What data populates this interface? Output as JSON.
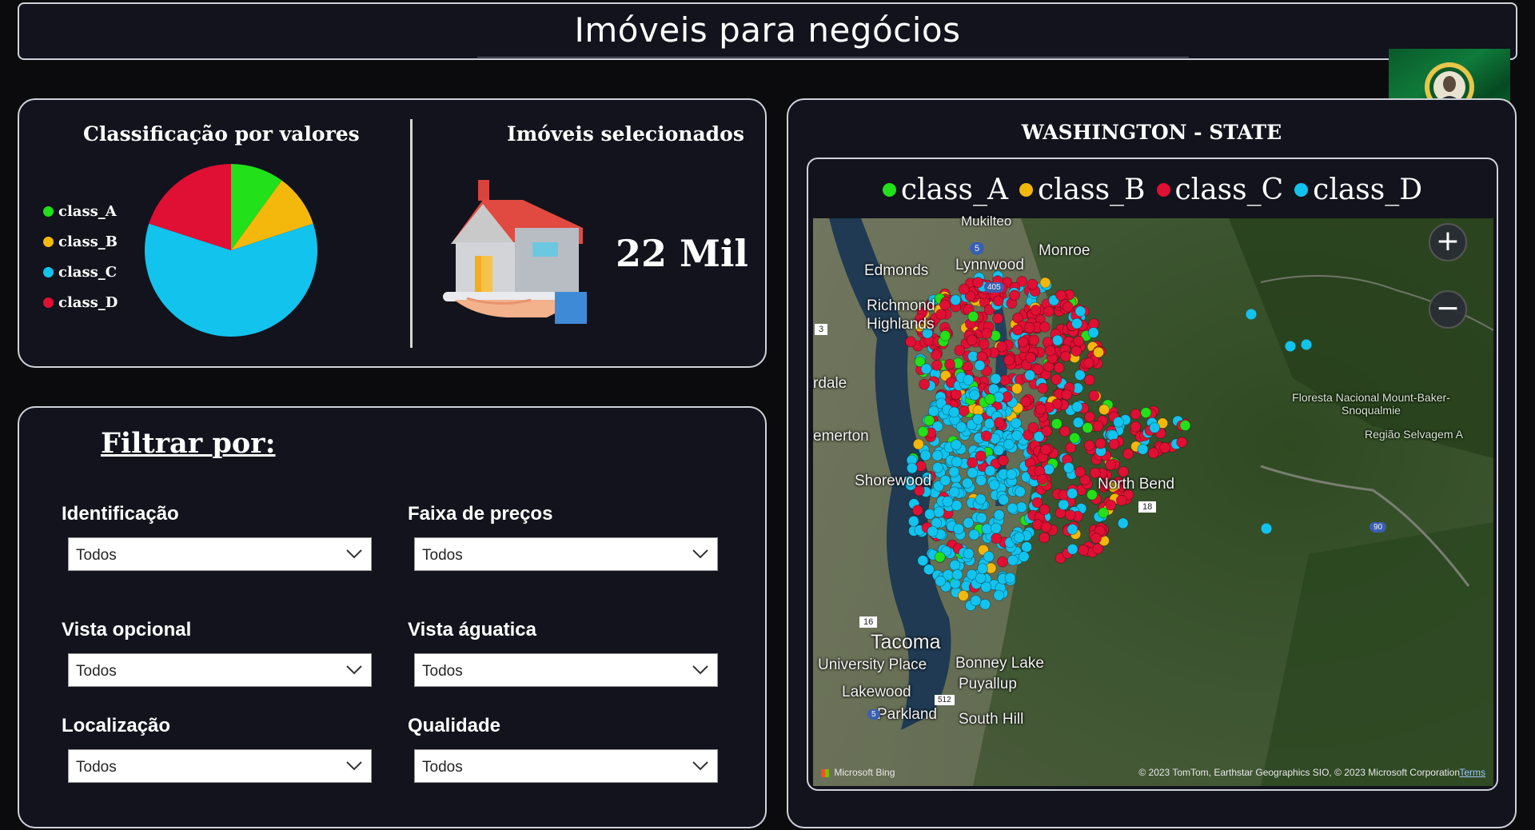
{
  "header": {
    "title": "Imóveis para negócios"
  },
  "summary": {
    "pie_title": "Classificação por valores",
    "kpi_title": "Imóveis selecionados",
    "kpi_value": "22 Mil",
    "legend": [
      {
        "label": "class_A",
        "color": "#22e01a"
      },
      {
        "label": "class_B",
        "color": "#f4b80c"
      },
      {
        "label": "class_C",
        "color": "#12c3ee"
      },
      {
        "label": "class_D",
        "color": "#e00f34"
      }
    ]
  },
  "chart_data": {
    "type": "pie",
    "title": "Classificação por valores",
    "categories": [
      "class_A",
      "class_B",
      "class_C",
      "class_D"
    ],
    "values": [
      10,
      10,
      60,
      20
    ],
    "colors": [
      "#22e01a",
      "#f4b80c",
      "#12c3ee",
      "#e00f34"
    ],
    "legend_position": "left"
  },
  "filters": {
    "title": "Filtrar por:",
    "items": [
      {
        "label": "Identificação",
        "value": "Todos"
      },
      {
        "label": "Faixa de preços",
        "value": "Todos"
      },
      {
        "label": "Vista opcional",
        "value": "Todos"
      },
      {
        "label": "Vista águatica",
        "value": "Todos"
      },
      {
        "label": "Localização",
        "value": "Todos"
      },
      {
        "label": "Qualidade",
        "value": "Todos"
      }
    ]
  },
  "map": {
    "title": "WASHINGTON - STATE",
    "legend": [
      {
        "label": "class_A",
        "color": "#22e01a"
      },
      {
        "label": "class_B",
        "color": "#f4b80c"
      },
      {
        "label": "class_C",
        "color": "#e00f34"
      },
      {
        "label": "class_D",
        "color": "#12c3ee"
      }
    ],
    "zoom_in": "+",
    "zoom_out": "−",
    "brand": "Microsoft Bing",
    "attribution": "© 2023 TomTom, Earthstar Geographics SIO, © 2023 Microsoft Corporation",
    "terms": "Terms",
    "places": [
      "Mukilteo",
      "Monroe",
      "Edmonds",
      "Lynnwood",
      "Richmond Highlands",
      "Floresta Nacional Mount-Baker-Snoqualmie",
      "Região Selvagem A",
      "Shorewood",
      "North Bend",
      "Tacoma",
      "University Place",
      "Bonney Lake",
      "Puyallup",
      "Lakewood",
      "Parkland",
      "South Hill",
      "rdale",
      "emerton"
    ],
    "road_shields": [
      "5",
      "405",
      "3",
      "18",
      "16",
      "512",
      "5",
      "90"
    ]
  }
}
